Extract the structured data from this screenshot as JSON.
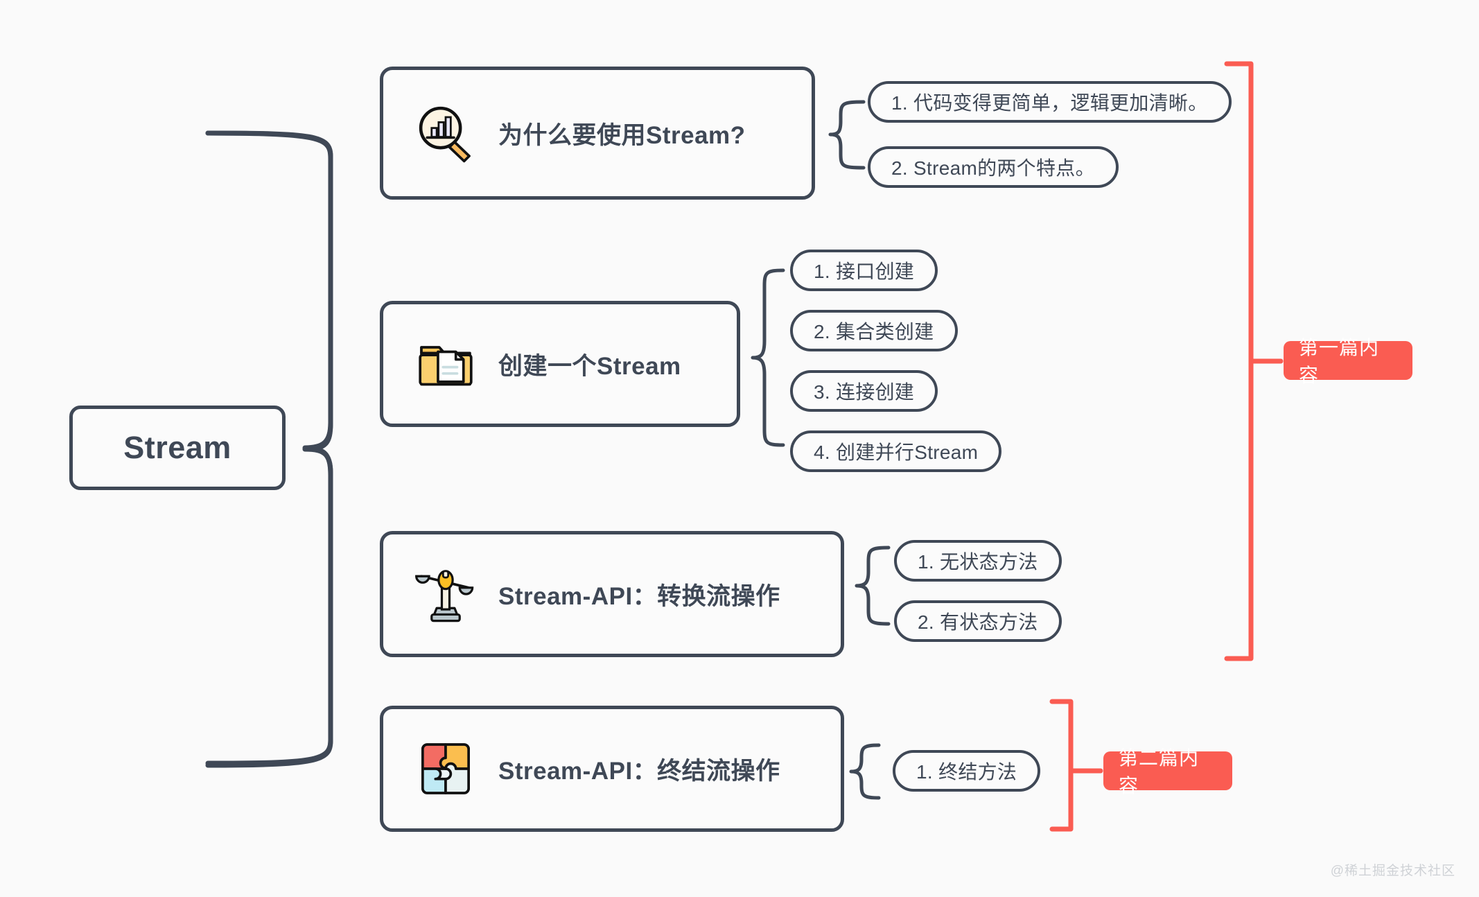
{
  "theme": {
    "background": "#fafafa",
    "node_stroke": "#3f4856",
    "node_fill": "#fbfbfb",
    "accent_red": "#fa5c52",
    "icon_yellow": "#fbc55a",
    "watermark_color": "#cfd2d6"
  },
  "root": {
    "label": "Stream"
  },
  "branches": [
    {
      "id": "why-stream",
      "label": "为什么要使用Stream?",
      "icon": "magnifier-chart-icon",
      "leaves": [
        {
          "label": "1. 代码变得更简单，逻辑更加清晰。"
        },
        {
          "label": "2. Stream的两个特点。"
        }
      ]
    },
    {
      "id": "create-stream",
      "label": "创建一个Stream",
      "icon": "folder-document-icon",
      "leaves": [
        {
          "label": "1. 接口创建"
        },
        {
          "label": "2. 集合类创建"
        },
        {
          "label": "3. 连接创建"
        },
        {
          "label": "4. 创建并行Stream"
        }
      ]
    },
    {
      "id": "stream-api-intermediate",
      "label": "Stream-API：转换流操作",
      "icon": "balance-scale-icon",
      "leaves": [
        {
          "label": "1. 无状态方法"
        },
        {
          "label": "2. 有状态方法"
        }
      ]
    },
    {
      "id": "stream-api-terminal",
      "label": "Stream-API：终结流操作",
      "icon": "puzzle-icon",
      "leaves": [
        {
          "label": "1. 终结方法"
        }
      ]
    }
  ],
  "badges": [
    {
      "id": "part-one",
      "label": "第一篇内容"
    },
    {
      "id": "part-two",
      "label": "第二篇内容"
    }
  ],
  "watermark": {
    "label": "@稀土掘金技术社区"
  }
}
